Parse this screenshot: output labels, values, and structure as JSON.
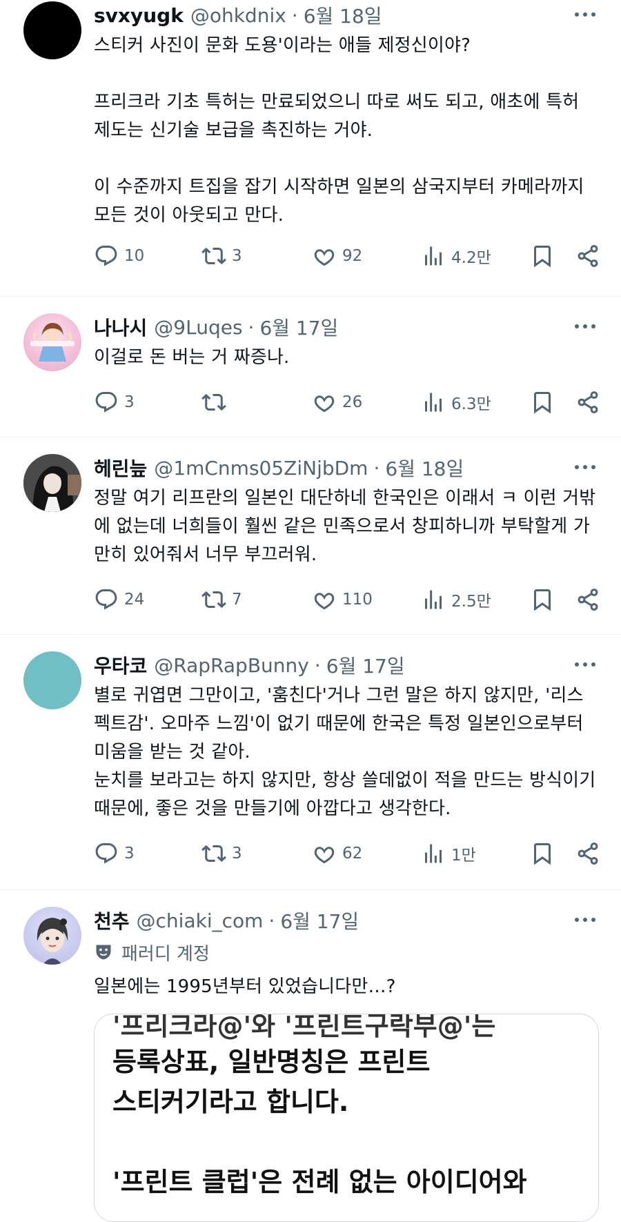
{
  "posts": [
    {
      "name": "svxyugk",
      "handle": "@ohkdnix",
      "date": "6월 18일",
      "separator": "·",
      "text": "스티커 사진이 문화 도용'이라는 애들 제정신이야?\n\n프리크라 기초 특허는 만료되었으니 따로 써도 되고, 애초에 특허 제도는 신기술 보급을 촉진하는 거야.\n\n이 수준까지 트집을 잡기 시작하면 일본의 삼국지부터 카메라까지 모든 것이 아웃되고 만다.",
      "replies": "10",
      "reposts": "3",
      "likes": "92",
      "views": "4.2만",
      "avatar_color": "#000000"
    },
    {
      "name": "나나시",
      "handle": "@9Luqes",
      "date": "6월 17일",
      "separator": "·",
      "text": "이걸로 돈 버는 거 짜증나.",
      "replies": "3",
      "reposts": "",
      "likes": "26",
      "views": "6.3만",
      "avatar_color": "#f4d4e4"
    },
    {
      "name": "헤린늪",
      "handle": "@1mCnms05ZiNjbDm",
      "date": "6월 18일",
      "separator": "·",
      "text": "정말 여기 리프란의 일본인 대단하네 한국인은 이래서 ㅋ 이런 거밖에 없는데 너희들이 훨씬 같은 민족으로서 창피하니까 부탁할게 가만히 있어줘서 너무 부끄러워.",
      "replies": "24",
      "reposts": "7",
      "likes": "110",
      "views": "2.5만",
      "avatar_color": "#2a2a2a"
    },
    {
      "name": "우타코",
      "handle": "@RapRapBunny",
      "date": "6월 17일",
      "separator": "·",
      "text": "별로 귀엽면 그만이고, '훔친다'거나 그런 말은 하지 않지만, '리스펙트감'. 오마주 느낌'이 없기 때문에 한국은 특정 일본인으로부터 미움을 받는 것 같아.\n눈치를 보라고는 하지 않지만, 항상 쓸데없이 적을 만드는 방식이기 때문에, 좋은 것을 만들기에 아깝다고 생각한다.",
      "replies": "3",
      "reposts": "3",
      "likes": "62",
      "views": "1만",
      "avatar_color": "#6fbfc4"
    },
    {
      "name": "천추",
      "handle": "@chiaki_com",
      "date": "6월 17일",
      "separator": "·",
      "parody_label": "패러디 계정",
      "text": "일본에는 1995년부터 있었습니다만…?",
      "quote_lines": [
        "'프리크라@'와 '프린트구락부@'는",
        "등록상표, 일반명칭은 프린트",
        "스티커기라고 합니다.",
        "",
        "'프린트 클럽'은 전례 없는 아이디어와"
      ],
      "avatar_color": "#b9bde8"
    }
  ],
  "colors": {
    "text": "#0f1419",
    "secondary": "#536471",
    "divider": "#eff3f4"
  }
}
